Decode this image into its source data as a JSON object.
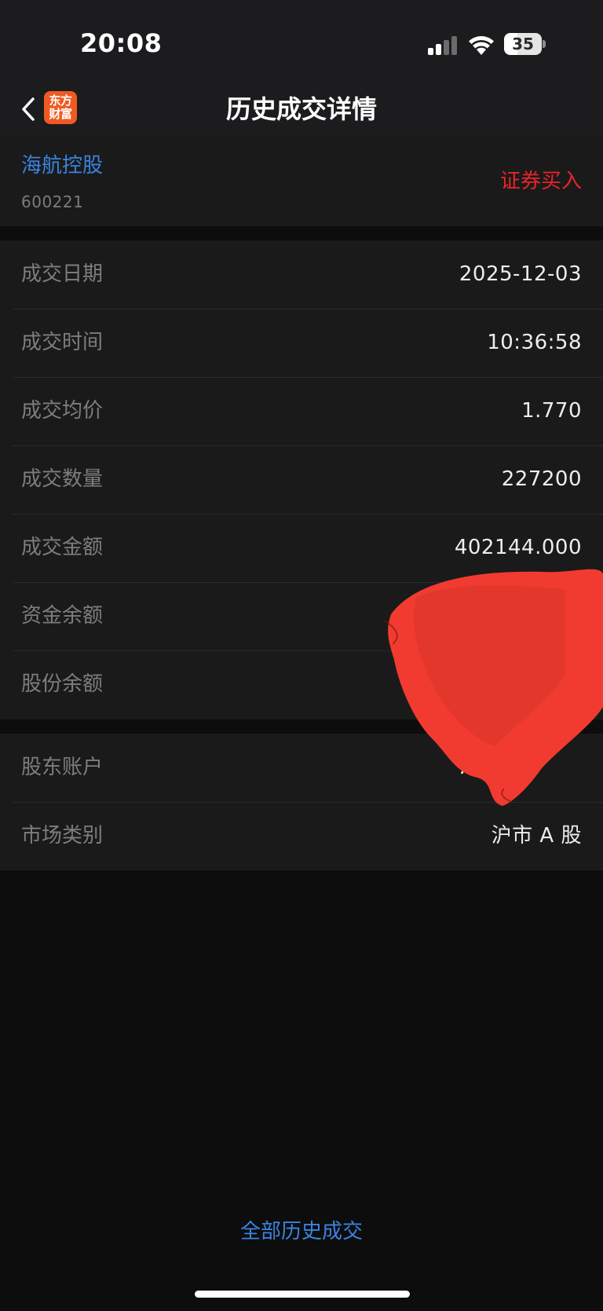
{
  "status_bar": {
    "time": "20:08",
    "battery_level": "35",
    "icons": [
      "signal-icon",
      "wifi-icon",
      "battery-icon"
    ]
  },
  "nav": {
    "back_icon": "chevron-left-icon",
    "logo_line1": "东方",
    "logo_line2": "财富",
    "title": "历史成交详情"
  },
  "stock": {
    "name": "海航控股",
    "code": "600221",
    "trade_type": "证券买入"
  },
  "details": [
    {
      "label": "成交日期",
      "value": "2025-12-03"
    },
    {
      "label": "成交时间",
      "value": "10:36:58"
    },
    {
      "label": "成交均价",
      "value": "1.770"
    },
    {
      "label": "成交数量",
      "value": "227200"
    },
    {
      "label": "成交金额",
      "value": "402144.000"
    },
    {
      "label": "资金余额",
      "value": ""
    },
    {
      "label": "股份余额",
      "value": ""
    }
  ],
  "account": [
    {
      "label": "股东账户",
      "value": "A774"
    },
    {
      "label": "市场类别",
      "value": "沪市 A 股"
    }
  ],
  "footer": {
    "all_history": "全部历史成交"
  },
  "colors": {
    "accent_blue": "#3a83e0",
    "buy_red": "#e8242a",
    "redaction_red": "#f23b30",
    "logo_orange": "#f05a22"
  }
}
